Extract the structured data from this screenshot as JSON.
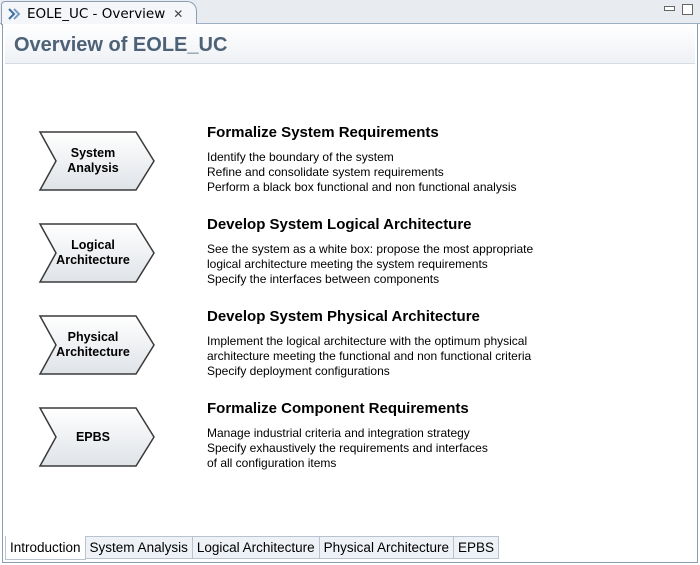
{
  "window": {
    "tab_title": "EOLE_UC - Overview",
    "tab_icon": "capella-editor-icon",
    "close_icon": "close-icon",
    "minimize_icon": "minimize-icon",
    "maximize_icon": "maximize-icon"
  },
  "header": {
    "title": "Overview of EOLE_UC"
  },
  "rows": [
    {
      "chevron_label": "System\nAnalysis",
      "title": "Formalize System Requirements",
      "description": "Identify the boundary of the system\nRefine and consolidate system requirements\nPerform a black box functional and non functional analysis"
    },
    {
      "chevron_label": "Logical\nArchitecture",
      "title": "Develop System Logical Architecture",
      "description": "See the system as a white box: propose the most appropriate\nlogical architecture meeting the system requirements\nSpecify the interfaces between components"
    },
    {
      "chevron_label": "Physical\nArchitecture",
      "title": "Develop System Physical Architecture",
      "description": "Implement the logical architecture with the optimum physical\narchitecture meeting the functional and non functional criteria\nSpecify deployment configurations"
    },
    {
      "chevron_label": "EPBS",
      "title": "Formalize Component Requirements",
      "description": "Manage industrial criteria and integration strategy\nSpecify exhaustively the requirements and interfaces\nof all configuration items"
    }
  ],
  "bottom_tabs": [
    {
      "label": "Introduction",
      "active": true
    },
    {
      "label": "System Analysis",
      "active": false
    },
    {
      "label": "Logical Architecture",
      "active": false
    },
    {
      "label": "Physical Architecture",
      "active": false
    },
    {
      "label": "EPBS",
      "active": false
    }
  ]
}
